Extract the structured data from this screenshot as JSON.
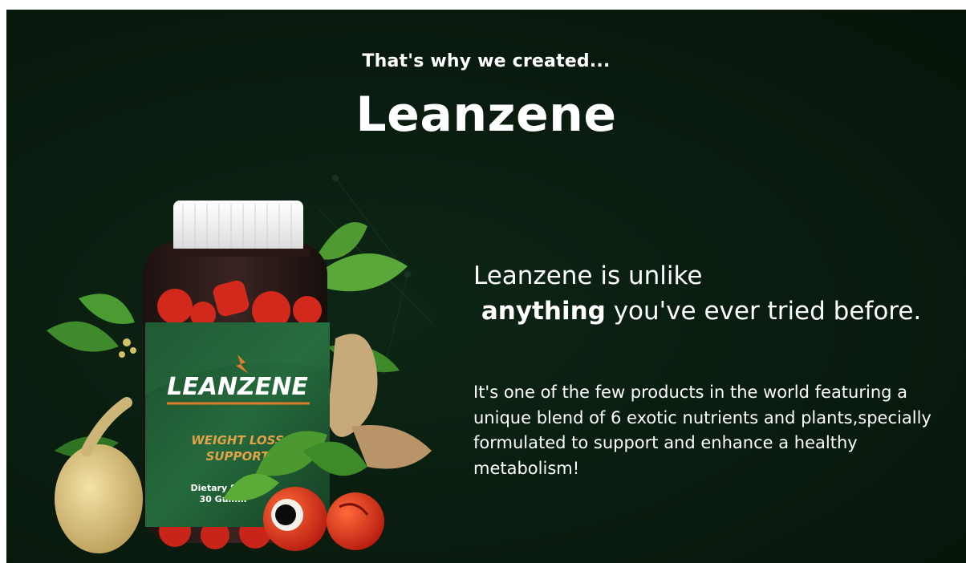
{
  "section": {
    "eyebrow": "That's why we created...",
    "title": "Leanzene"
  },
  "headline": {
    "part1": "Leanzene is unlike",
    "emphasis": "anything",
    "part2": "you've ever tried before."
  },
  "description": "It's one of the few products in the world featuring a unique blend of 6 exotic nutrients and plants,specially formulated to support and enhance a healthy metabolism!",
  "product_image": {
    "brand": "LEANZENE",
    "tagline_line1": "WEIGHT LOSS",
    "tagline_line2": "SUPPORT",
    "label_line1": "Dietary Supp",
    "label_line2": "30 Gumm"
  },
  "colors": {
    "background": "#0a1d10",
    "label_green": "#1f5a34",
    "accent_orange": "#e07b2a",
    "gummy_red": "#d3291d"
  }
}
